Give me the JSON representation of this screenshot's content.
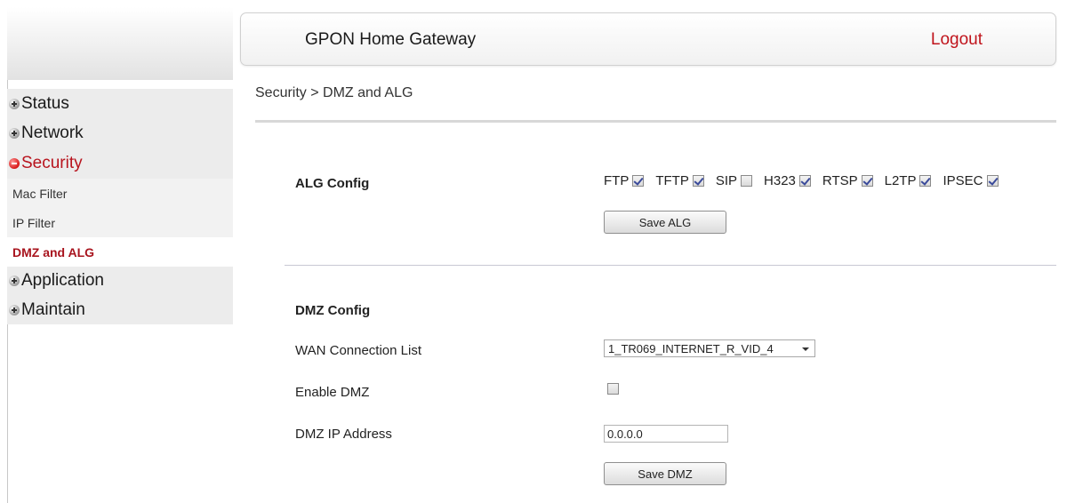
{
  "header": {
    "title": "GPON Home Gateway",
    "logout": "Logout"
  },
  "breadcrumb": "Security > DMZ and ALG",
  "sidebar": {
    "items": [
      {
        "label": "Status",
        "expanded": false
      },
      {
        "label": "Network",
        "expanded": false
      },
      {
        "label": "Security",
        "expanded": true,
        "subitems": [
          {
            "label": "Mac Filter"
          },
          {
            "label": "IP Filter"
          },
          {
            "label": "DMZ and ALG",
            "current": true
          }
        ]
      },
      {
        "label": "Application",
        "expanded": false
      },
      {
        "label": "Maintain",
        "expanded": false
      }
    ]
  },
  "alg": {
    "title": "ALG Config",
    "options": [
      {
        "label": "FTP",
        "checked": true
      },
      {
        "label": "TFTP",
        "checked": true
      },
      {
        "label": "SIP",
        "checked": false
      },
      {
        "label": "H323",
        "checked": true
      },
      {
        "label": "RTSP",
        "checked": true
      },
      {
        "label": "L2TP",
        "checked": true
      },
      {
        "label": "IPSEC",
        "checked": true
      }
    ],
    "save_label": "Save ALG"
  },
  "dmz": {
    "title": "DMZ Config",
    "wan_label": "WAN Connection List",
    "wan_value": "1_TR069_INTERNET_R_VID_4",
    "enable_label": "Enable DMZ",
    "enable_checked": false,
    "ip_label": "DMZ IP Address",
    "ip_value": "0.0.0.0",
    "save_label": "Save DMZ"
  },
  "colors": {
    "accent": "#b8141e",
    "sidebar_bg": "#ececec"
  },
  "icons": {
    "collapsed": "plus-circle-icon",
    "expanded": "minus-circle-icon",
    "checkbox": "checkbox-icon"
  }
}
